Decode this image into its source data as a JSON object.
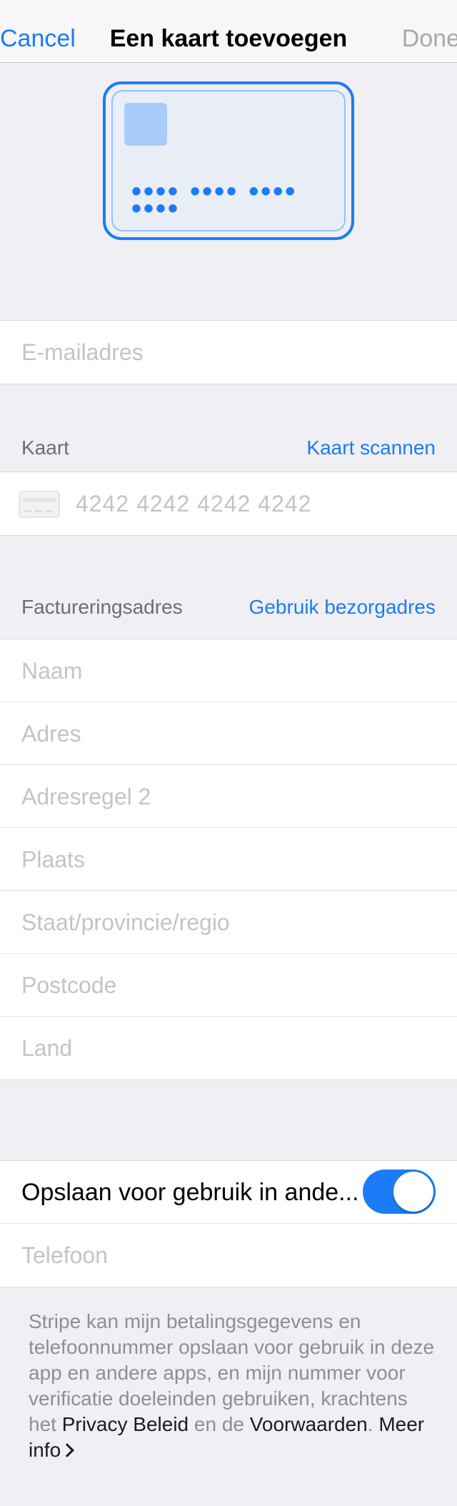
{
  "nav": {
    "cancel": "Cancel",
    "title": "Een kaart toevoegen",
    "done": "Done"
  },
  "card_preview": {
    "number_mask": "•••• •••• •••• ••••"
  },
  "email": {
    "placeholder": "E-mailadres"
  },
  "card_section": {
    "header": "Kaart",
    "action": "Kaart scannen",
    "number_placeholder": "4242 4242 4242 4242",
    "card_icon_name": "credit-card-icon"
  },
  "billing": {
    "header": "Factureringsadres",
    "action": "Gebruik bezorgadres",
    "fields": [
      {
        "placeholder": "Naam"
      },
      {
        "placeholder": "Adres"
      },
      {
        "placeholder": "Adresregel 2"
      },
      {
        "placeholder": "Plaats"
      },
      {
        "placeholder": "Staat/provincie/regio"
      },
      {
        "placeholder": "Postcode"
      },
      {
        "placeholder": "Land"
      }
    ]
  },
  "save": {
    "label": "Opslaan voor gebruik in ande...",
    "toggle_on": true,
    "phone_placeholder": "Telefoon"
  },
  "footer": {
    "text_1": "Stripe kan mijn betalingsgegevens en telefoonnummer opslaan voor gebruik in deze app en andere apps, en mijn nummer voor verificatie doeleinden gebruiken, krachtens het ",
    "privacy_link": "Privacy Beleid",
    "text_2": " en de ",
    "terms_link": "Voorwaarden",
    "text_3": ". ",
    "more_info_link": "Meer info"
  },
  "colors": {
    "accent": "#1a7cf6",
    "background": "#efeff4",
    "placeholder": "#c4c4c8"
  }
}
